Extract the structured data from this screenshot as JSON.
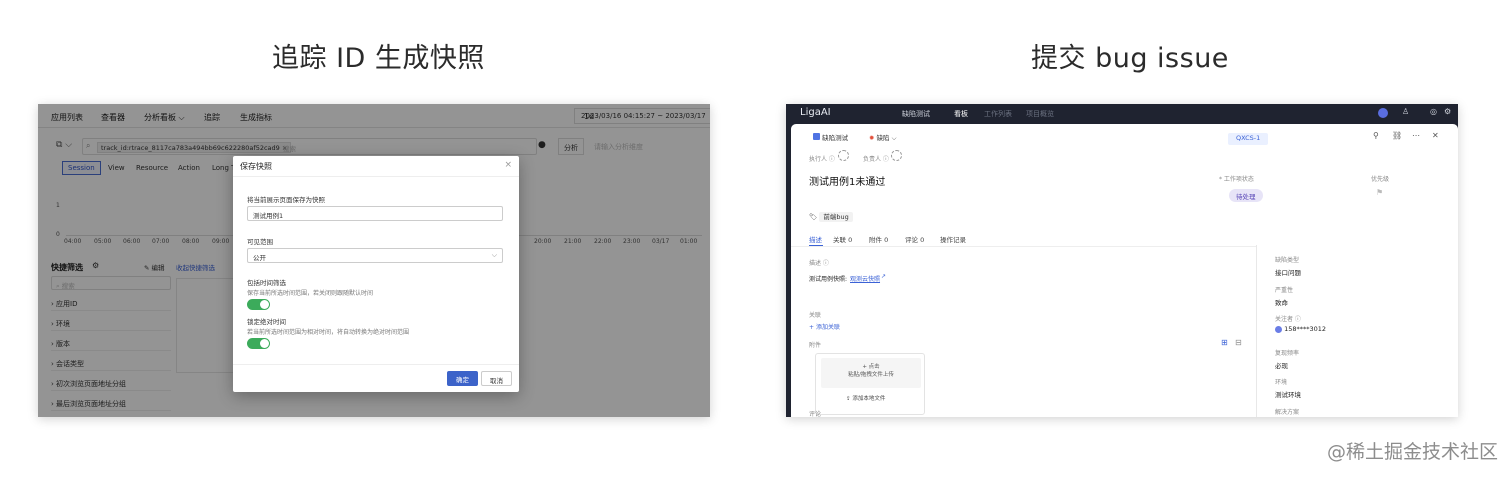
{
  "captions": {
    "left": "追踪 ID 生成快照",
    "right": "提交 bug issue"
  },
  "watermark": "@稀土掘金技术社区",
  "left_screen": {
    "nav": [
      "应用列表",
      "查看器",
      "分析看板 ⌵",
      "追踪",
      "生成指标"
    ],
    "range_unit": "1d",
    "time_range": "2023/03/16 04:15:27 ~ 2023/03/17",
    "search_tag": "track_id:rtrace_8117ca783a494bb69c622280af52cad9",
    "search_placeholder": "搜索",
    "analyze_button": "分析",
    "analyze_placeholder": "请输入分析维度",
    "tabs": [
      "Session",
      "View",
      "Resource",
      "Action",
      "Long Ta"
    ],
    "y_ticks": [
      "1",
      "0"
    ],
    "x_ticks": [
      "04:00",
      "05:00",
      "06:00",
      "07:00",
      "08:00",
      "09:00",
      "20:00",
      "21:00",
      "22:00",
      "23:00",
      "03/17",
      "01:00"
    ],
    "quick_filter": {
      "title": "快捷筛选",
      "edit": "编辑",
      "collect": "收起快捷筛选",
      "search_placeholder": "搜索",
      "items": [
        "应用ID",
        "环境",
        "版本",
        "会话类型",
        "初次浏览页面地址分组",
        "最后浏览页面地址分组"
      ]
    },
    "modal": {
      "title": "保存快照",
      "close": "×",
      "name_label": "将当前展示页面保存为快照",
      "name_value": "测试用例1",
      "scope_label": "可见范围",
      "scope_value": "公开",
      "time_filter_label": "包括时间筛选",
      "time_filter_desc": "保存当前所选时间范围，若关闭则跟随默认时间",
      "absolute_label": "锁定绝对时间",
      "absolute_desc": "若当前所选时间范围为相对时间，将自动转换为绝对时间范围",
      "ok": "确定",
      "cancel": "取消"
    }
  },
  "right_screen": {
    "logo": "LigaAI",
    "app_tabs": [
      "缺陷测试",
      "看板",
      "工作列表",
      "项目概览"
    ],
    "crumb_project": "缺陷测试",
    "crumb_type": "缺陷",
    "issue_key": "QXCS-1",
    "assignee_label": "执行人",
    "owner_label": "负责人",
    "title": "测试用例1未通过",
    "status_label": "* 工作项状态",
    "status_value": "待处理",
    "priority_label": "优先级",
    "tag": "前端bug",
    "tabs": [
      "描述",
      "关联 0",
      "附件 0",
      "评论 0",
      "操作记录"
    ],
    "desc_label": "描述",
    "desc_text": "测试用例快照:",
    "desc_link": "观测云快照",
    "relation_label": "关联",
    "add_relation": "添加关联",
    "attach_label": "附件",
    "upload_click": "+ 点击",
    "upload_hint": "粘贴/拖拽文件上传",
    "upload_local": "添加本地文件",
    "comment_label": "评论",
    "fields": [
      {
        "label": "缺陷类型",
        "value": "接口问题"
      },
      {
        "label": "严重性",
        "value": "致命"
      },
      {
        "label": "关注者",
        "value": "158****3012"
      },
      {
        "label": "复现频率",
        "value": "必现"
      },
      {
        "label": "环境",
        "value": "测试环境"
      },
      {
        "label": "解决方案",
        "value": ""
      }
    ]
  }
}
